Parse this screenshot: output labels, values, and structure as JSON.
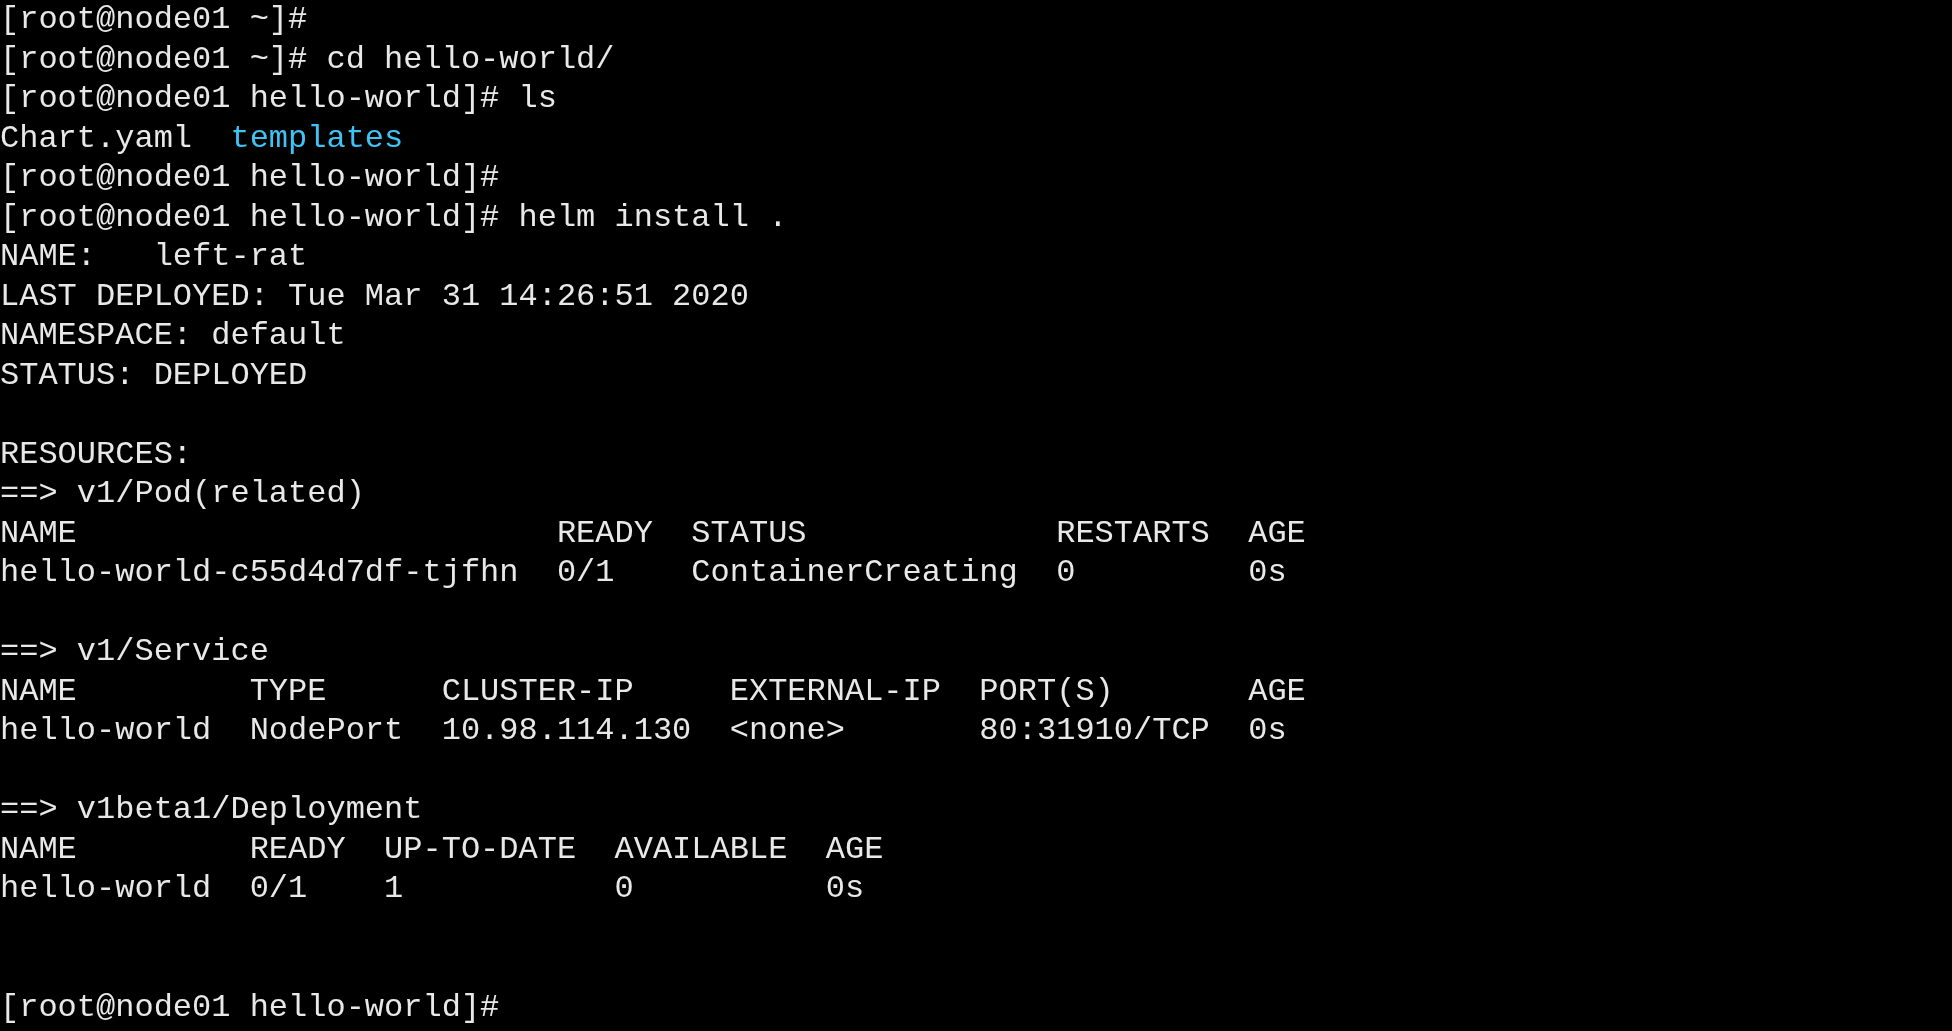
{
  "terminal": {
    "lines": [
      {
        "kind": "text",
        "text": "[root@node01 ~]#"
      },
      {
        "kind": "text",
        "text": "[root@node01 ~]# cd hello-world/"
      },
      {
        "kind": "text",
        "text": "[root@node01 hello-world]# ls"
      },
      {
        "kind": "listing",
        "entries": [
          {
            "kind": "file",
            "text": "Chart.yaml"
          },
          {
            "kind": "dir",
            "text": "templates"
          }
        ]
      },
      {
        "kind": "text",
        "text": "[root@node01 hello-world]#"
      },
      {
        "kind": "text",
        "text": "[root@node01 hello-world]# helm install ."
      },
      {
        "kind": "text",
        "text": "NAME:   left-rat"
      },
      {
        "kind": "text",
        "text": "LAST DEPLOYED: Tue Mar 31 14:26:51 2020"
      },
      {
        "kind": "text",
        "text": "NAMESPACE: default"
      },
      {
        "kind": "text",
        "text": "STATUS: DEPLOYED"
      },
      {
        "kind": "blank"
      },
      {
        "kind": "text",
        "text": "RESOURCES:"
      },
      {
        "kind": "text",
        "text": "==> v1/Pod(related)"
      },
      {
        "kind": "text",
        "text": "NAME                         READY  STATUS             RESTARTS  AGE"
      },
      {
        "kind": "text",
        "text": "hello-world-c55d4d7df-tjfhn  0/1    ContainerCreating  0         0s"
      },
      {
        "kind": "blank"
      },
      {
        "kind": "text",
        "text": "==> v1/Service"
      },
      {
        "kind": "text",
        "text": "NAME         TYPE      CLUSTER-IP     EXTERNAL-IP  PORT(S)       AGE"
      },
      {
        "kind": "text",
        "text": "hello-world  NodePort  10.98.114.130  <none>       80:31910/TCP  0s"
      },
      {
        "kind": "blank"
      },
      {
        "kind": "text",
        "text": "==> v1beta1/Deployment"
      },
      {
        "kind": "text",
        "text": "NAME         READY  UP-TO-DATE  AVAILABLE  AGE"
      },
      {
        "kind": "text",
        "text": "hello-world  0/1    1           0          0s"
      },
      {
        "kind": "blank"
      },
      {
        "kind": "blank"
      },
      {
        "kind": "text",
        "text": "[root@node01 hello-world]#"
      }
    ]
  }
}
